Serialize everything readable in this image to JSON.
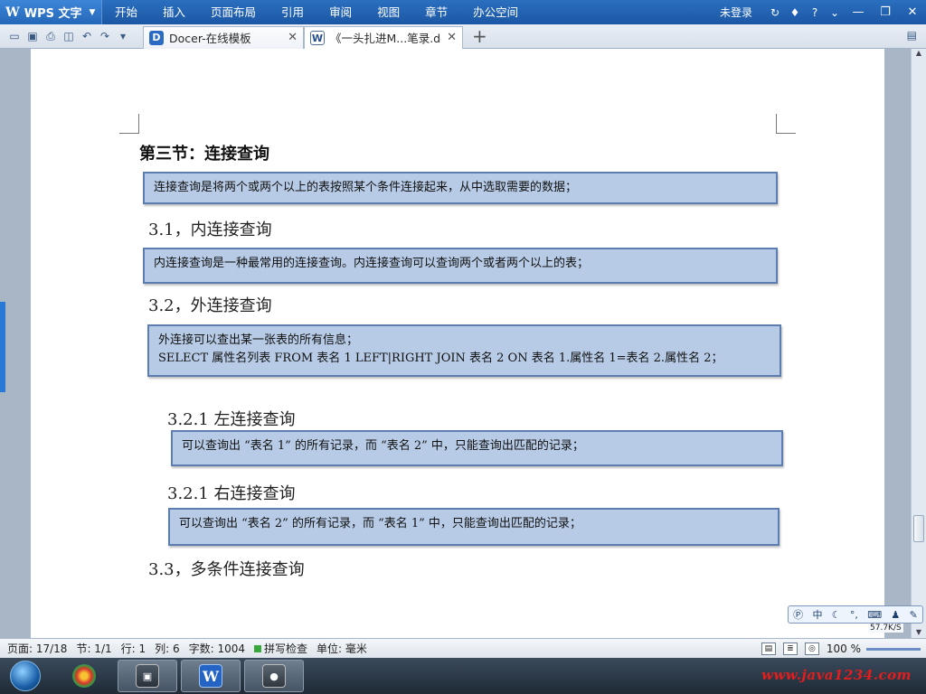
{
  "app": {
    "name": "WPS 文字",
    "menu": [
      "开始",
      "插入",
      "页面布局",
      "引用",
      "审阅",
      "视图",
      "章节",
      "办公空间"
    ],
    "login": "未登录"
  },
  "tabs": [
    {
      "label": "Docer-在线模板"
    },
    {
      "label": "《一头扎进M...笔录.doc"
    }
  ],
  "doc": {
    "title": "第三节：连接查询",
    "intro": "连接查询是将两个或两个以上的表按照某个条件连接起来，从中选取需要的数据；",
    "s31": {
      "heading": "3.1，内连接查询",
      "text": "内连接查询是一种最常用的连接查询。内连接查询可以查询两个或者两个以上的表；"
    },
    "s32": {
      "heading": "3.2，外连接查询",
      "line1": "外连接可以查出某一张表的所有信息；",
      "line2": "SELECT  属性名列表  FROM   表名 1 LEFT|RIGHT JOIN  表名 2 ON  表名 1.属性名 1=表名 2.属性名 2；"
    },
    "s321a": {
      "heading": "3.2.1  左连接查询",
      "text": "可以查询出 “表名 1” 的所有记录，而 “表名 2” 中，只能查询出匹配的记录；"
    },
    "s321b": {
      "heading": "3.2.1  右连接查询",
      "text": "可以查询出 “表名 2” 的所有记录，而 “表名 1” 中，只能查询出匹配的记录；"
    },
    "s33": {
      "heading": "3.3，多条件连接查询"
    }
  },
  "status": {
    "page": "页面: 17/18",
    "section": "节: 1/1",
    "row": "行: 1",
    "col": "列: 6",
    "words": "字数: 1004",
    "spell": "拼写检查",
    "unit": "单位: 毫米",
    "zoom": "100 %"
  },
  "ime": {
    "mode": "中"
  },
  "speed": "57.7K/S",
  "watermark": "www.java1234.com"
}
